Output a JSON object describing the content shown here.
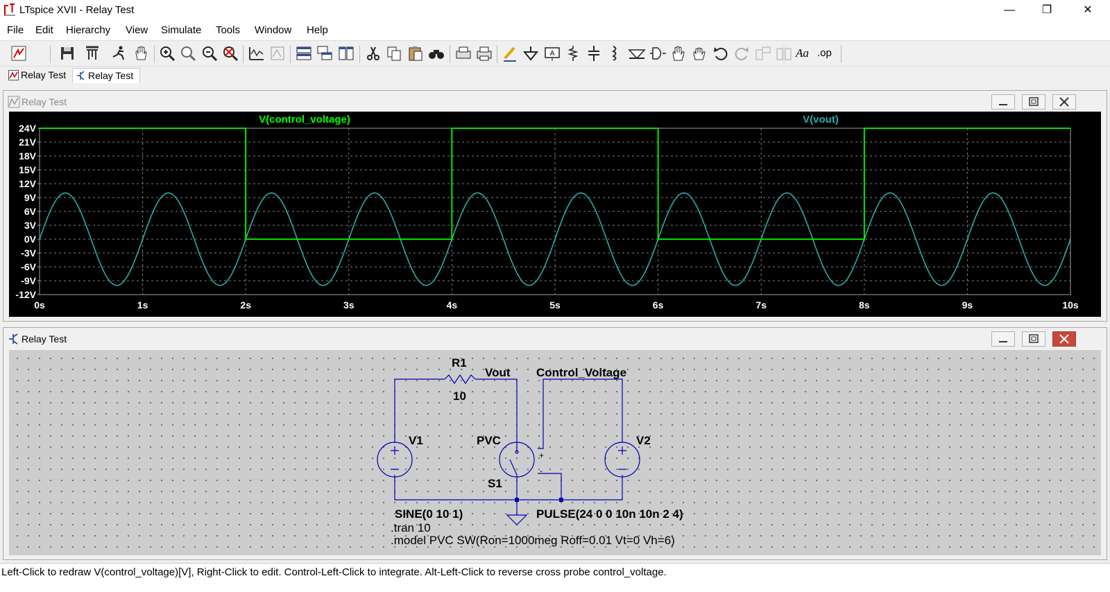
{
  "window": {
    "title": "LTspice XVII - Relay Test",
    "minimize": "—",
    "maximize": "❐",
    "close": "✕"
  },
  "menu": [
    "File",
    "Edit",
    "Hierarchy",
    "View",
    "Simulate",
    "Tools",
    "Window",
    "Help"
  ],
  "toolbar": {
    "icons": [
      "new-schematic-icon",
      "save-icon",
      "control-panel-icon",
      "run-icon",
      "halt-icon",
      "zoom-in-icon",
      "zoom-pan-icon",
      "zoom-out-icon",
      "zoom-fit-icon",
      "autorange-icon",
      "waveform-icon",
      "tile-horizontal-icon",
      "cascade-icon",
      "tile-vertical-icon",
      "cut-icon",
      "copy-icon",
      "paste-icon",
      "find-icon",
      "print-setup-icon",
      "print-icon",
      "wire-icon",
      "ground-icon",
      "label-icon",
      "resistor-icon",
      "capacitor-icon",
      "inductor-icon",
      "diode-icon",
      "component-icon",
      "move-icon",
      "drag-icon",
      "undo-icon",
      "redo-icon",
      "rotate-icon",
      "mirror-icon",
      "text-icon",
      "spice-directive-icon"
    ],
    "text_label": "Aa",
    "op_label": ".op"
  },
  "tabs": [
    {
      "label": "Relay Test",
      "icon": "waveform-tab-icon",
      "active": false
    },
    {
      "label": "Relay Test",
      "icon": "schematic-tab-icon",
      "active": true
    }
  ],
  "waveform_window": {
    "title": "Relay Test"
  },
  "schematic_window": {
    "title": "Relay Test"
  },
  "chart_data": {
    "type": "line",
    "xlabel": "",
    "ylabel": "",
    "xlim": [
      0,
      10
    ],
    "ylim": [
      -12,
      24
    ],
    "grid": true,
    "x_ticks": [
      0,
      1,
      2,
      3,
      4,
      5,
      6,
      7,
      8,
      9,
      10
    ],
    "x_tick_labels": [
      "0s",
      "1s",
      "2s",
      "3s",
      "4s",
      "5s",
      "6s",
      "7s",
      "8s",
      "9s",
      "10s"
    ],
    "y_ticks": [
      24,
      21,
      18,
      15,
      12,
      9,
      6,
      3,
      0,
      -3,
      -6,
      -9,
      -12
    ],
    "y_tick_labels": [
      "24V",
      "21V",
      "18V",
      "15V",
      "12V",
      "9V",
      "6V",
      "3V",
      "0V",
      "-3V",
      "-6V",
      "-9V",
      "-12V"
    ],
    "series": [
      {
        "name": "V(control_voltage)",
        "color": "#00ff00",
        "kind": "pulse",
        "v1": 24,
        "v2": 0,
        "period": 4,
        "on_time": 2,
        "x": [
          0,
          2,
          2,
          4,
          4,
          6,
          6,
          8,
          8,
          10
        ],
        "y": [
          24,
          24,
          0,
          0,
          24,
          24,
          0,
          0,
          24,
          24
        ]
      },
      {
        "name": "V(vout)",
        "color": "#2aaaa8",
        "kind": "sine",
        "offset": 0,
        "amplitude": 10,
        "frequency": 1
      }
    ]
  },
  "schematic": {
    "labels": {
      "r1_name": "R1",
      "r1_value": "10",
      "vout": "Vout",
      "control_voltage": "Control_Voltage",
      "v1_name": "V1",
      "v2_name": "V2",
      "pvc": "PVC",
      "s1": "S1",
      "v1_value": "SINE(0 10 1)",
      "v2_value": "PULSE(24 0 0 10n 10n 2 4)",
      "tran": ".tran 10",
      "model": ".model PVC SW(Ron=1000meg Roff=0.01 Vt=0 Vh=6)",
      "plus": "+",
      "minus": "-"
    }
  },
  "status": "Left-Click to redraw V(control_voltage)[V],  Right-Click to edit. Control-Left-Click to integrate. Alt-Left-Click to reverse cross probe control_voltage."
}
